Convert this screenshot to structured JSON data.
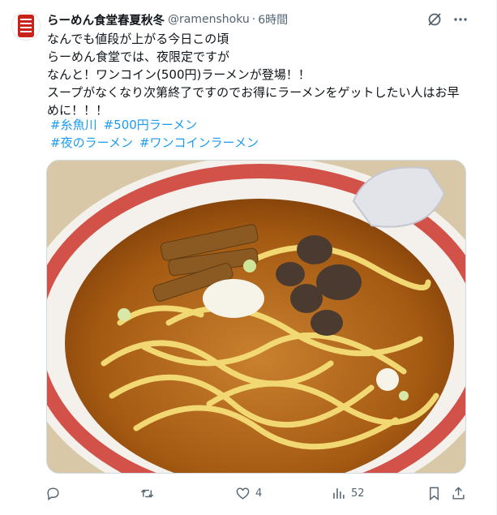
{
  "author": {
    "display_name": "らーめん食堂春夏秋冬",
    "handle": "@ramenshoku",
    "separator": "·",
    "time": "6時間",
    "avatar_icon": "ramen-shop-logo"
  },
  "text_lines": [
    "なんでも値段が上がる今日この頃",
    "らーめん食堂では、夜限定ですが",
    "なんと！ワンコイン(500円)ラーメンが登場！！",
    "スープがなくなり次第終了ですのでお得にラーメンをゲットしたい人はお早",
    "めに！！！"
  ],
  "hashtags_row1": [
    "#糸魚川",
    "#500円ラーメン"
  ],
  "hashtags_row2": [
    "#夜のラーメン",
    "#ワンコインラーメン"
  ],
  "media": {
    "kind": "photo",
    "subject": "ramen bowl"
  },
  "actions": {
    "reply": {
      "icon": "reply-icon",
      "count": ""
    },
    "repost": {
      "icon": "repost-icon",
      "count": ""
    },
    "like": {
      "icon": "heart-icon",
      "count": "4"
    },
    "views": {
      "icon": "views-icon",
      "count": "52"
    },
    "bookmark": {
      "icon": "bookmark-icon"
    },
    "share": {
      "icon": "share-icon"
    }
  },
  "colors": {
    "link": "#1d9bf0",
    "secondary_text": "#536471",
    "border": "#cfd9de"
  }
}
